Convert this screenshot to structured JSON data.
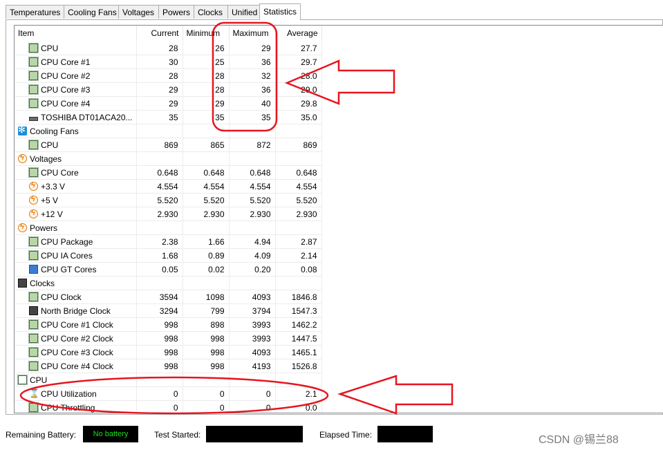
{
  "tabs": [
    {
      "label": "Temperatures",
      "active": false
    },
    {
      "label": "Cooling Fans",
      "active": false
    },
    {
      "label": "Voltages",
      "active": false
    },
    {
      "label": "Powers",
      "active": false
    },
    {
      "label": "Clocks",
      "active": false
    },
    {
      "label": "Unified",
      "active": false
    },
    {
      "label": "Statistics",
      "active": true
    }
  ],
  "columns": {
    "item": "Item",
    "current": "Current",
    "minimum": "Minimum",
    "maximum": "Maximum",
    "average": "Average"
  },
  "rows": [
    {
      "type": "item",
      "icon": "chip-icon",
      "label": "CPU",
      "current": "28",
      "minimum": "26",
      "maximum": "29",
      "average": "27.7"
    },
    {
      "type": "item",
      "icon": "chip-icon",
      "label": "CPU Core #1",
      "current": "30",
      "minimum": "25",
      "maximum": "36",
      "average": "29.7"
    },
    {
      "type": "item",
      "icon": "chip-icon",
      "label": "CPU Core #2",
      "current": "28",
      "minimum": "28",
      "maximum": "32",
      "average": "28.0"
    },
    {
      "type": "item",
      "icon": "chip-icon",
      "label": "CPU Core #3",
      "current": "29",
      "minimum": "28",
      "maximum": "36",
      "average": "29.0"
    },
    {
      "type": "item",
      "icon": "chip-icon",
      "label": "CPU Core #4",
      "current": "29",
      "minimum": "29",
      "maximum": "40",
      "average": "29.8"
    },
    {
      "type": "item",
      "icon": "hdd-icon",
      "label": "TOSHIBA DT01ACA20...",
      "current": "35",
      "minimum": "35",
      "maximum": "35",
      "average": "35.0"
    },
    {
      "type": "category",
      "icon": "fan-icon",
      "label": "Cooling Fans"
    },
    {
      "type": "item",
      "icon": "chip-icon",
      "label": "CPU",
      "current": "869",
      "minimum": "865",
      "maximum": "872",
      "average": "869"
    },
    {
      "type": "category",
      "icon": "voltage-icon",
      "label": "Voltages"
    },
    {
      "type": "item",
      "icon": "chip-icon",
      "label": "CPU Core",
      "current": "0.648",
      "minimum": "0.648",
      "maximum": "0.648",
      "average": "0.648"
    },
    {
      "type": "item",
      "icon": "voltage-icon",
      "label": "+3.3 V",
      "current": "4.554",
      "minimum": "4.554",
      "maximum": "4.554",
      "average": "4.554"
    },
    {
      "type": "item",
      "icon": "voltage-icon",
      "label": "+5 V",
      "current": "5.520",
      "minimum": "5.520",
      "maximum": "5.520",
      "average": "5.520"
    },
    {
      "type": "item",
      "icon": "voltage-icon",
      "label": "+12 V",
      "current": "2.930",
      "minimum": "2.930",
      "maximum": "2.930",
      "average": "2.930"
    },
    {
      "type": "category",
      "icon": "voltage-icon",
      "label": "Powers"
    },
    {
      "type": "item",
      "icon": "chip-icon",
      "label": "CPU Package",
      "current": "2.38",
      "minimum": "1.66",
      "maximum": "4.94",
      "average": "2.87"
    },
    {
      "type": "item",
      "icon": "chip-icon",
      "label": "CPU IA Cores",
      "current": "1.68",
      "minimum": "0.89",
      "maximum": "4.09",
      "average": "2.14"
    },
    {
      "type": "item",
      "icon": "monitor-icon",
      "label": "CPU GT Cores",
      "current": "0.05",
      "minimum": "0.02",
      "maximum": "0.20",
      "average": "0.08"
    },
    {
      "type": "category",
      "icon": "motherboard-icon",
      "label": "Clocks"
    },
    {
      "type": "item",
      "icon": "chip-icon",
      "label": "CPU Clock",
      "current": "3594",
      "minimum": "1098",
      "maximum": "4093",
      "average": "1846.8"
    },
    {
      "type": "item",
      "icon": "motherboard-icon",
      "label": "North Bridge Clock",
      "current": "3294",
      "minimum": "799",
      "maximum": "3794",
      "average": "1547.3"
    },
    {
      "type": "item",
      "icon": "chip-icon",
      "label": "CPU Core #1 Clock",
      "current": "998",
      "minimum": "898",
      "maximum": "3993",
      "average": "1462.2"
    },
    {
      "type": "item",
      "icon": "chip-icon",
      "label": "CPU Core #2 Clock",
      "current": "998",
      "minimum": "998",
      "maximum": "3993",
      "average": "1447.5"
    },
    {
      "type": "item",
      "icon": "chip-icon",
      "label": "CPU Core #3 Clock",
      "current": "998",
      "minimum": "998",
      "maximum": "4093",
      "average": "1465.1"
    },
    {
      "type": "item",
      "icon": "chip-icon",
      "label": "CPU Core #4 Clock",
      "current": "998",
      "minimum": "998",
      "maximum": "4193",
      "average": "1526.8"
    },
    {
      "type": "category",
      "icon": "cpu-icon",
      "label": "CPU"
    },
    {
      "type": "item",
      "icon": "hourglass-icon",
      "label": "CPU Utilization",
      "current": "0",
      "minimum": "0",
      "maximum": "0",
      "average": "2.1"
    },
    {
      "type": "item",
      "icon": "chip-icon",
      "label": "CPU Throttling",
      "current": "0",
      "minimum": "0",
      "maximum": "0",
      "average": "0.0"
    }
  ],
  "bottom": {
    "battery_label": "Remaining Battery:",
    "battery_value": "No battery",
    "test_started_label": "Test Started:",
    "elapsed_label": "Elapsed Time:"
  },
  "watermark": "CSDN @锡兰88",
  "colors": {
    "annotation": "#e8141e",
    "battery_text": "#17e217"
  }
}
